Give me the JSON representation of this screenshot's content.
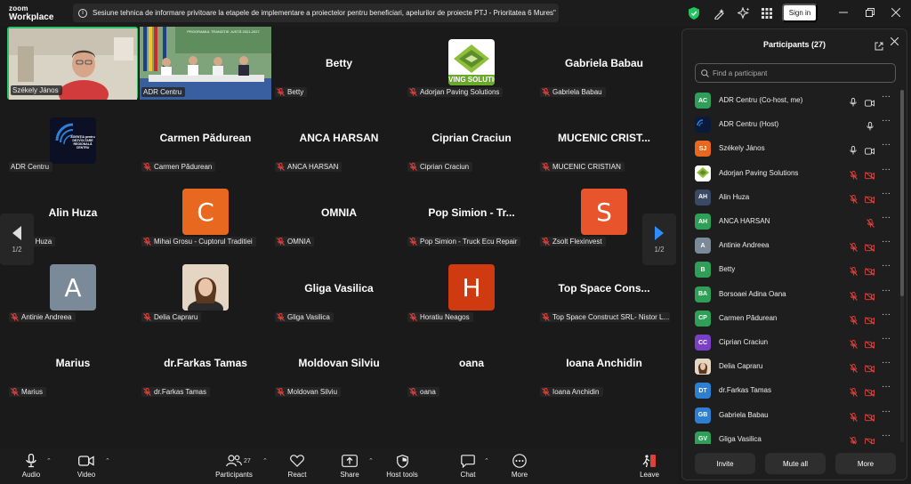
{
  "app": {
    "logo_top": "zoom",
    "logo_bottom": "Workplace"
  },
  "meeting": {
    "topic": "Sesiune tehnica de informare privitoare la etapele de implementare a proiectelor pentru beneficiari, apelurilor de proiecte  PTJ - Prioritatea 6 Mures\""
  },
  "header": {
    "sign_in": "Sign in"
  },
  "gallery": {
    "tiles": [
      {
        "name": "Székely János",
        "big": "",
        "kind": "video-man",
        "muted": false
      },
      {
        "name": "ADR Centru",
        "big": "",
        "kind": "video-room",
        "muted": false
      },
      {
        "name": "Betty",
        "big": "Betty",
        "kind": "name",
        "muted": true
      },
      {
        "name": "Adorjan Paving Solutions",
        "big": "",
        "kind": "logo-ving",
        "muted": true
      },
      {
        "name": "Gabriela Babau",
        "big": "Gabriela Babau",
        "kind": "name",
        "muted": true
      },
      {
        "name": "ADR Centru",
        "big": "",
        "kind": "logo-adr",
        "muted": false
      },
      {
        "name": "Carmen Pădurean",
        "big": "Carmen Pădurean",
        "kind": "name",
        "muted": true
      },
      {
        "name": "ANCA HARSAN",
        "big": "ANCA HARSAN",
        "kind": "name",
        "muted": true
      },
      {
        "name": "Ciprian Craciun",
        "big": "Ciprian Craciun",
        "kind": "name",
        "muted": true
      },
      {
        "name": "MUCENIC CRISTIAN",
        "big": "MUCENIC  CRIST...",
        "kind": "name",
        "muted": true
      },
      {
        "name": "Alin Huza",
        "big": "Alin Huza",
        "kind": "name",
        "muted": true
      },
      {
        "name": "Mihai Grosu - Cuptorul Traditiei",
        "big": "C",
        "kind": "avatar",
        "color": "#e8681f",
        "muted": true
      },
      {
        "name": "OMNIA",
        "big": "OMNIA",
        "kind": "name",
        "muted": true
      },
      {
        "name": "Pop Simion - Truck Ecu Repair",
        "big": "Pop Simion - Tr...",
        "kind": "name",
        "muted": true
      },
      {
        "name": "Zsolt Flexinvest",
        "big": "S",
        "kind": "avatar",
        "color": "#e8542b",
        "muted": true
      },
      {
        "name": "Antinie Andreea",
        "big": "A",
        "kind": "avatar",
        "color": "#7b8a99",
        "muted": true
      },
      {
        "name": "Delia Capraru",
        "big": "",
        "kind": "photo-woman",
        "muted": true
      },
      {
        "name": "Gliga Vasilica",
        "big": "Gliga Vasilica",
        "kind": "name",
        "muted": true
      },
      {
        "name": "Horatiu Neagos",
        "big": "H",
        "kind": "avatar",
        "color": "#cf3a10",
        "muted": true
      },
      {
        "name": "Top Space Construct SRL- Nistor L...",
        "big": "Top Space Cons...",
        "kind": "name",
        "muted": true
      },
      {
        "name": "Marius",
        "big": "Marius",
        "kind": "name",
        "muted": true
      },
      {
        "name": "dr.Farkas Tamas",
        "big": "dr.Farkas Tamas",
        "kind": "name",
        "muted": true
      },
      {
        "name": "Moldovan Silviu",
        "big": "Moldovan Silviu",
        "kind": "name",
        "muted": true
      },
      {
        "name": "oana",
        "big": "oana",
        "kind": "name",
        "muted": true
      },
      {
        "name": "Ioana Anchidin",
        "big": "Ioana Anchidin",
        "kind": "name",
        "muted": true
      }
    ],
    "video_room_banner": "PROGRAMUL TRANZIȚIE JUSTĂ 2021-2027",
    "adr_logo_text": "AGENȚIA pentru DEZVOLTARE REGIONALĂ CENTRU",
    "ving_logo_text": "VING SOLUTIO",
    "prev_page": "1/2",
    "next_page": "1/2"
  },
  "toolbar": {
    "audio": "Audio",
    "video": "Video",
    "participants": "Participants",
    "participants_count": "27",
    "react": "React",
    "share": "Share",
    "host_tools": "Host tools",
    "chat": "Chat",
    "more": "More",
    "leave": "Leave"
  },
  "panel": {
    "title": "Participants (27)",
    "search_placeholder": "Find a participant",
    "participants": [
      {
        "initials": "AC",
        "name": "ADR Centru (Co-host, me)",
        "color": "#2f9e57",
        "mic": "on",
        "cam": "on"
      },
      {
        "initials": "",
        "name": "ADR Centru (Host)",
        "color": "#0b1a3a",
        "mic": "on",
        "cam": "none"
      },
      {
        "initials": "SJ",
        "name": "Székely János",
        "color": "#e8681f",
        "mic": "on",
        "cam": "on"
      },
      {
        "initials": "",
        "name": "Adorjan Paving Solutions",
        "color": "#ffffff",
        "mic": "off",
        "cam": "off"
      },
      {
        "initials": "AH",
        "name": "Alin Huza",
        "color": "#3a4a66",
        "mic": "off",
        "cam": "off"
      },
      {
        "initials": "AH",
        "name": "ANCA HARSAN",
        "color": "#2f9e57",
        "mic": "off",
        "cam": "none"
      },
      {
        "initials": "A",
        "name": "Antinie Andreea",
        "color": "#7b8a99",
        "mic": "off",
        "cam": "off"
      },
      {
        "initials": "B",
        "name": "Betty",
        "color": "#2f9e57",
        "mic": "off",
        "cam": "off"
      },
      {
        "initials": "BA",
        "name": "Borsoaei Adina Oana",
        "color": "#2f9e57",
        "mic": "off",
        "cam": "off"
      },
      {
        "initials": "CP",
        "name": "Carmen Pădurean",
        "color": "#2f9e57",
        "mic": "off",
        "cam": "off"
      },
      {
        "initials": "CC",
        "name": "Ciprian Craciun",
        "color": "#7a3fc4",
        "mic": "off",
        "cam": "off"
      },
      {
        "initials": "",
        "name": "Delia Capraru",
        "color": "#c9b29a",
        "mic": "off",
        "cam": "off"
      },
      {
        "initials": "DT",
        "name": "dr.Farkas Tamas",
        "color": "#2c7fd1",
        "mic": "off",
        "cam": "off"
      },
      {
        "initials": "GB",
        "name": "Gabriela Babau",
        "color": "#2c7fd1",
        "mic": "off",
        "cam": "off"
      },
      {
        "initials": "GV",
        "name": "Gliga Vasilica",
        "color": "#2f9e57",
        "mic": "off",
        "cam": "off"
      }
    ],
    "invite": "Invite",
    "mute_all": "Mute all",
    "more": "More"
  },
  "colors": {
    "accent_green": "#27c46b",
    "muted_red": "#e0403a",
    "shield_green": "#21c55d"
  }
}
